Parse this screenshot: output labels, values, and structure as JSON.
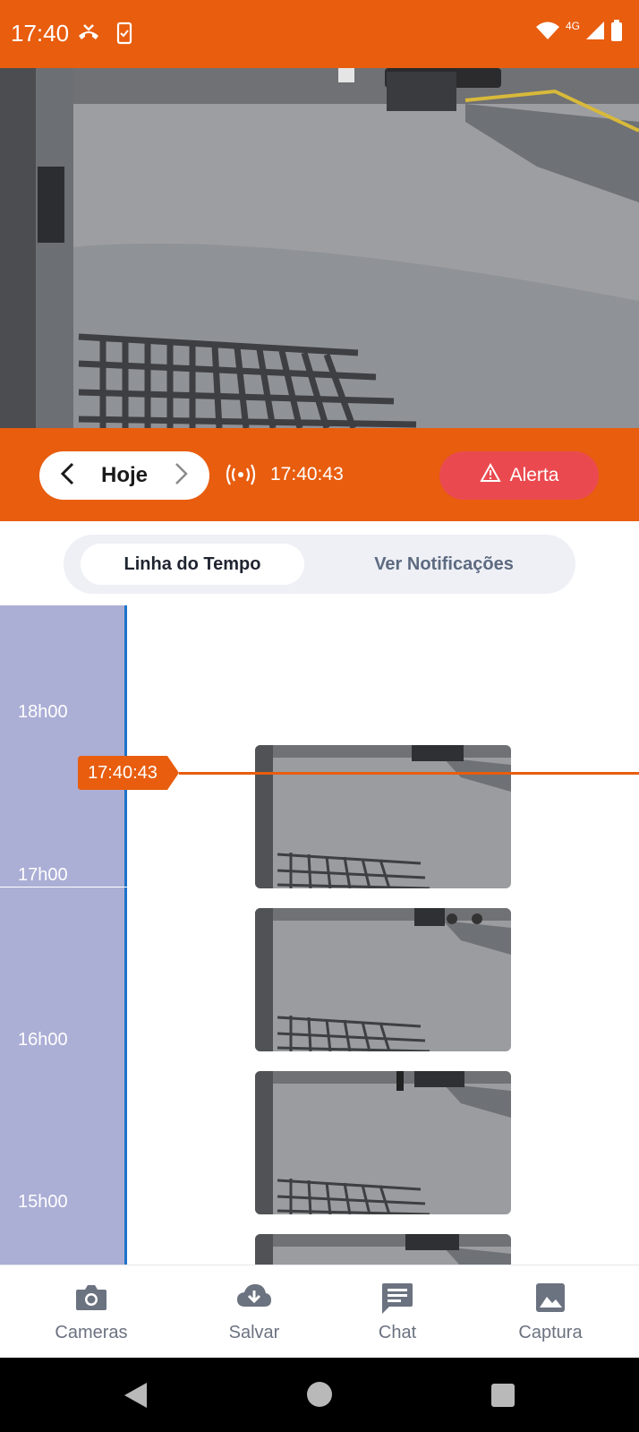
{
  "status_bar": {
    "time": "17:40",
    "network": "4G",
    "icons": [
      "missed-call-icon",
      "phone-screen-icon",
      "wifi-icon",
      "signal-icon",
      "battery-icon"
    ]
  },
  "camera": {
    "feed_description_icon": "camera-feed"
  },
  "controls": {
    "day_label": "Hoje",
    "live_time": "17:40:43",
    "alert_label": "Alerta"
  },
  "tabs": {
    "timeline": "Linha do Tempo",
    "notifications": "Ver Notificações"
  },
  "timeline": {
    "hours": [
      "18h00",
      "17h00",
      "16h00",
      "15h00"
    ],
    "current_time": "17:40:43"
  },
  "bottom_nav": {
    "items": [
      {
        "label": "Cameras",
        "icon": "camera-icon"
      },
      {
        "label": "Salvar",
        "icon": "cloud-download-icon"
      },
      {
        "label": "Chat",
        "icon": "chat-icon"
      },
      {
        "label": "Captura",
        "icon": "image-icon"
      }
    ]
  },
  "colors": {
    "accent": "#e85d0e",
    "alert": "#ea4a4f",
    "timeline_bar": "#abaed5",
    "timeline_border": "#1e73c8"
  }
}
